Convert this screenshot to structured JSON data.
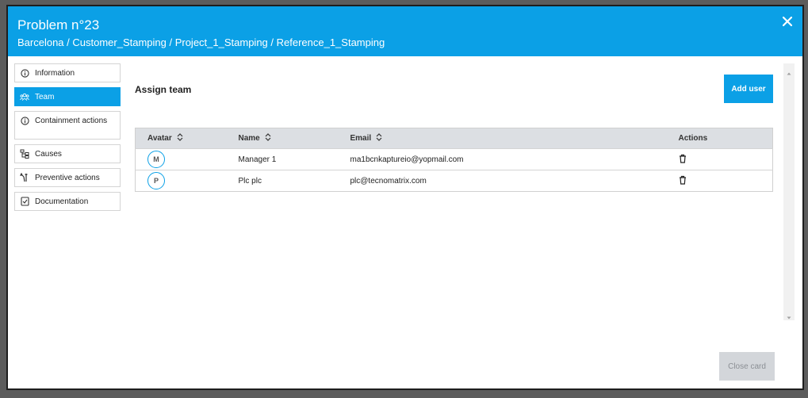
{
  "modal": {
    "title": "Problem n°23",
    "breadcrumb": "Barcelona / Customer_Stamping / Project_1_Stamping / Reference_1_Stamping",
    "close_icon": "close-icon"
  },
  "sidebar": {
    "items": [
      {
        "label": "Information",
        "icon": "info-icon",
        "active": false
      },
      {
        "label": "Team",
        "icon": "team-icon",
        "active": true
      },
      {
        "label": "Containment actions",
        "icon": "info-icon",
        "active": false
      },
      {
        "label": "Causes",
        "icon": "tree-icon",
        "active": false
      },
      {
        "label": "Preventive actions",
        "icon": "wrench-icon",
        "active": false
      },
      {
        "label": "Documentation",
        "icon": "document-icon",
        "active": false
      }
    ]
  },
  "main": {
    "section_title": "Assign team",
    "add_user_label": "Add user",
    "close_card_label": "Close card",
    "table": {
      "columns": [
        "Avatar",
        "Name",
        "Email",
        "Actions"
      ],
      "rows": [
        {
          "avatar": "M",
          "name": "Manager 1",
          "email": "ma1bcnkaptureio@yopmail.com"
        },
        {
          "avatar": "P",
          "name": "Plc plc",
          "email": "plc@tecnomatrix.com"
        }
      ]
    }
  },
  "colors": {
    "accent": "#0ba0e6",
    "disabled_button": "#d3d6da",
    "table_header": "#dcdfe3"
  }
}
